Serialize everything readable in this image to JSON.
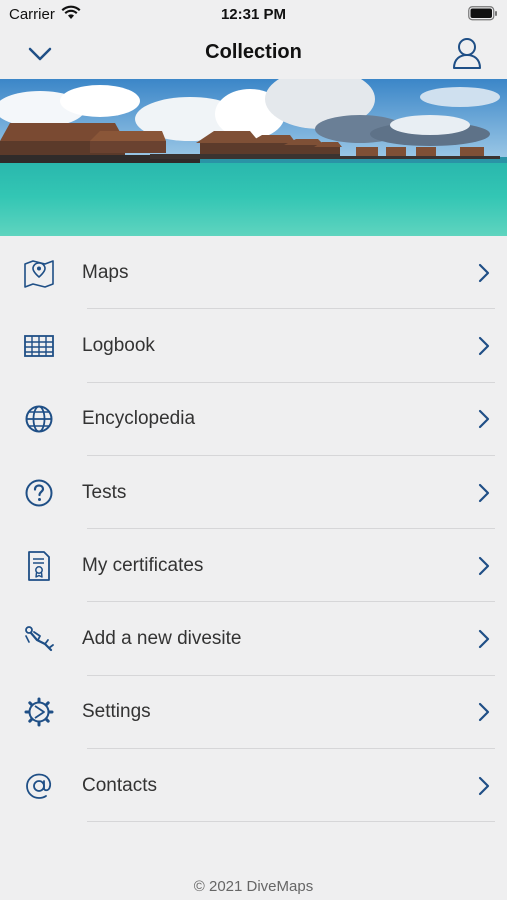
{
  "status_bar": {
    "carrier": "Carrier",
    "time": "12:31 PM"
  },
  "nav": {
    "title": "Collection"
  },
  "menu": {
    "items": [
      {
        "label": "Maps",
        "icon": "map-icon"
      },
      {
        "label": "Logbook",
        "icon": "logbook-icon"
      },
      {
        "label": "Encyclopedia",
        "icon": "globe-icon"
      },
      {
        "label": "Tests",
        "icon": "question-icon"
      },
      {
        "label": "My certificates",
        "icon": "certificate-icon"
      },
      {
        "label": "Add a new divesite",
        "icon": "diver-icon"
      },
      {
        "label": "Settings",
        "icon": "gear-icon"
      },
      {
        "label": "Contacts",
        "icon": "at-icon"
      }
    ]
  },
  "footer": {
    "copyright": "© 2021 DiveMaps"
  },
  "colors": {
    "accent": "#1f4f86",
    "background": "#efeff0"
  }
}
